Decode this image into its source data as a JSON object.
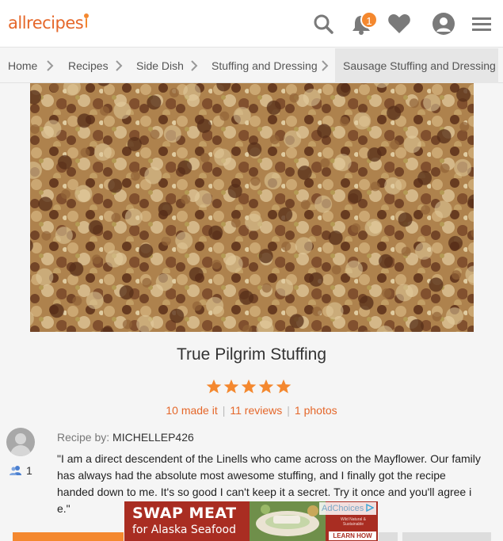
{
  "header": {
    "logo": "allrecipes",
    "notification_count": "1",
    "icons": [
      "search-icon",
      "bell-icon",
      "heart-icon",
      "profile-icon",
      "menu-icon"
    ]
  },
  "breadcrumb": {
    "items": [
      "Home",
      "Recipes",
      "Side Dish",
      "Stuffing and Dressing",
      "Sausage Stuffing and Dressing"
    ]
  },
  "review": {
    "title": "True Pilgrim Stuffing",
    "rating": 5,
    "made_it": "10 made it",
    "reviews": "11 reviews",
    "photos": "1 photos",
    "recipe_by_label": "Recipe by:",
    "author": "MICHELLEP426",
    "followers": "1",
    "quote": "\"I am a direct descendent of the Linells who came across on the Mayflower. Our family has always had the absolute most awesome stuffing, and I finally got the recipe handed down to me. It's so good I can't keep it a secret. Try it once and you'll agree i                                                          e.\""
  },
  "ad": {
    "line1": "SWAP MEAT",
    "line2": "for Alaska Seafood",
    "cta": "LEARN HOW",
    "fine_print": "Wild Natural & Sustainable",
    "adchoices": "AdChoices"
  },
  "colors": {
    "brand": "#e5672a",
    "star": "#f4882f",
    "ad_bg": "#a92d22"
  }
}
